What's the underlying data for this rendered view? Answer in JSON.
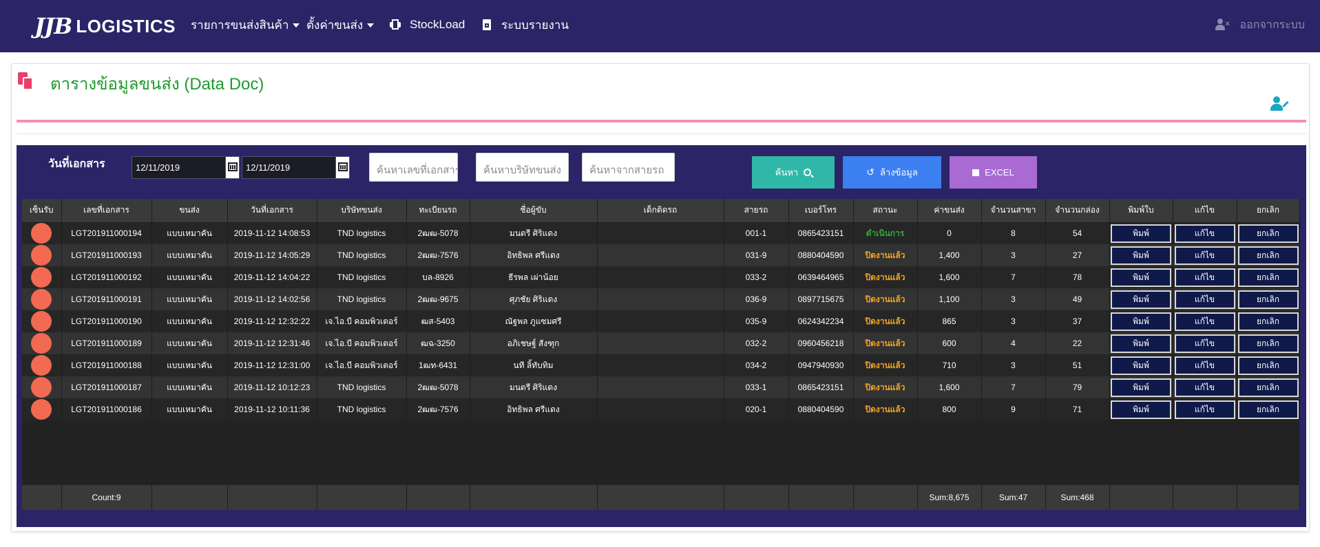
{
  "nav": {
    "logo_mark": "JJB",
    "logo_text": "LOGISTICS",
    "items": [
      {
        "label": "รายการขนส่งสินค้า",
        "icon": "caret-down-icon"
      },
      {
        "label": "ตั้งค่าขนส่ง",
        "icon": "caret-down-icon"
      },
      {
        "label": "StockLoad",
        "icon": "printer-icon"
      },
      {
        "label": "ระบบรายงาน",
        "icon": "document-icon"
      }
    ],
    "logout_label": "ออกจากระบบ"
  },
  "page": {
    "title": "ตารางข้อมูลขนส่ง (Data Doc)"
  },
  "filters": {
    "date_label": "วันที่เอกสาร",
    "date_from": "12/11/2019",
    "date_to": "12/11/2019",
    "search_doc_placeholder": "ค้นหาเลขที่เอกสาร",
    "search_company_placeholder": "ค้นหาบริษัทขนส่ง",
    "search_route_placeholder": "ค้นหาจากสายรถ",
    "search_button": "ค้นหา",
    "clear_button": "ล้างข้อมูล",
    "excel_button": "EXCEL"
  },
  "table": {
    "columns": [
      "เซ็นรับ",
      "เลขที่เอกสาร",
      "ขนส่ง",
      "วันที่เอกสาร",
      "บริษัทขนส่ง",
      "ทะเบียนรถ",
      "ชื่อผู้ขับ",
      "เด็กติดรถ",
      "สายรถ",
      "เบอร์โทร",
      "สถานะ",
      "ค่าขนส่ง",
      "จำนวนสาขา",
      "จำนวนกล่อง",
      "พิมพ์ใบ",
      "แก้ไข",
      "ยกเลิก"
    ],
    "action_print": "พิมพ์",
    "action_edit": "แก้ไข",
    "action_cancel": "ยกเลิก",
    "rows": [
      {
        "doc": "LGT201911000194",
        "type": "แบบเหมาคัน",
        "date": "2019-11-12 14:08:53",
        "company": "TND logistics",
        "plate": "2ฒฒ-5078",
        "driver": "มนตรี ศิริแดง",
        "helper": "",
        "route": "001-1",
        "phone": "0865423151",
        "status": "ดำเนินการ",
        "status_type": "progress",
        "fee": "0",
        "branches": "8",
        "boxes": "54"
      },
      {
        "doc": "LGT201911000193",
        "type": "แบบเหมาคัน",
        "date": "2019-11-12 14:05:29",
        "company": "TND logistics",
        "plate": "2ฒฒ-7576",
        "driver": "อิทธิพล ศรีแดง",
        "helper": "",
        "route": "031-9",
        "phone": "0880404590",
        "status": "ปิดงานแล้ว",
        "status_type": "closed",
        "fee": "1,400",
        "branches": "3",
        "boxes": "27"
      },
      {
        "doc": "LGT201911000192",
        "type": "แบบเหมาคัน",
        "date": "2019-11-12 14:04:22",
        "company": "TND logistics",
        "plate": "บล-8926",
        "driver": "ธีรพล เผ่าน้อย",
        "helper": "",
        "route": "033-2",
        "phone": "0639464965",
        "status": "ปิดงานแล้ว",
        "status_type": "closed",
        "fee": "1,600",
        "branches": "7",
        "boxes": "78"
      },
      {
        "doc": "LGT201911000191",
        "type": "แบบเหมาคัน",
        "date": "2019-11-12 14:02:56",
        "company": "TND logistics",
        "plate": "2ฒฒ-9675",
        "driver": "ศุภชัย ศิริแดง",
        "helper": "",
        "route": "036-9",
        "phone": "0897715675",
        "status": "ปิดงานแล้ว",
        "status_type": "closed",
        "fee": "1,100",
        "branches": "3",
        "boxes": "49"
      },
      {
        "doc": "LGT201911000190",
        "type": "แบบเหมาคัน",
        "date": "2019-11-12 12:32:22",
        "company": "เจ.ไอ.บี คอมพิวเตอร์",
        "plate": "ฒส-5403",
        "driver": "ณัฐพล ภูแซมศรี",
        "helper": "",
        "route": "035-9",
        "phone": "0624342234",
        "status": "ปิดงานแล้ว",
        "status_type": "closed",
        "fee": "865",
        "branches": "3",
        "boxes": "37"
      },
      {
        "doc": "LGT201911000189",
        "type": "แบบเหมาคัน",
        "date": "2019-11-12 12:31:46",
        "company": "เจ.ไอ.บี คอมพิวเตอร์",
        "plate": "ฒฉ-3250",
        "driver": "อภิเชษฐ์ สังฑุก",
        "helper": "",
        "route": "032-2",
        "phone": "0960456218",
        "status": "ปิดงานแล้ว",
        "status_type": "closed",
        "fee": "600",
        "branches": "4",
        "boxes": "22"
      },
      {
        "doc": "LGT201911000188",
        "type": "แบบเหมาคัน",
        "date": "2019-11-12 12:31:00",
        "company": "เจ.ไอ.บี คอมพิวเตอร์",
        "plate": "1ฒท-6431",
        "driver": "นที ลิ้ทับทิม",
        "helper": "",
        "route": "034-2",
        "phone": "0947940930",
        "status": "ปิดงานแล้ว",
        "status_type": "closed",
        "fee": "710",
        "branches": "3",
        "boxes": "51"
      },
      {
        "doc": "LGT201911000187",
        "type": "แบบเหมาคัน",
        "date": "2019-11-12 10:12:23",
        "company": "TND logistics",
        "plate": "2ฒฒ-5078",
        "driver": "มนตรี ศิริแดง",
        "helper": "",
        "route": "033-1",
        "phone": "0865423151",
        "status": "ปิดงานแล้ว",
        "status_type": "closed",
        "fee": "1,600",
        "branches": "7",
        "boxes": "79"
      },
      {
        "doc": "LGT201911000186",
        "type": "แบบเหมาคัน",
        "date": "2019-11-12 10:11:36",
        "company": "TND logistics",
        "plate": "2ฒฒ-7576",
        "driver": "อิทธิพล ศรีแดง",
        "helper": "",
        "route": "020-1",
        "phone": "0880404590",
        "status": "ปิดงานแล้ว",
        "status_type": "closed",
        "fee": "800",
        "branches": "9",
        "boxes": "71"
      }
    ],
    "footer": {
      "count": "Count:9",
      "sum_fee": "Sum:8,675",
      "sum_branches": "Sum:47",
      "sum_boxes": "Sum:468"
    }
  },
  "colors": {
    "navbar": "#2b2466",
    "title_green": "#1f9a2c",
    "accent_pink": "#f48fb1",
    "search_btn": "#2fb8a8",
    "clear_btn": "#3c7ff0",
    "excel_btn": "#a96ad4",
    "status_progress": "#34a83a",
    "status_closed": "#f5a623",
    "sign_dot": "#f26a51"
  }
}
